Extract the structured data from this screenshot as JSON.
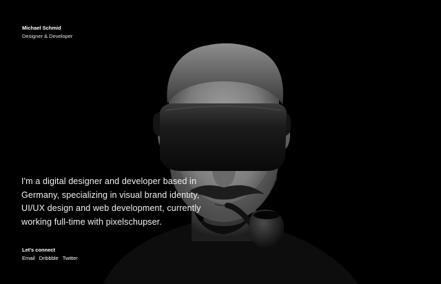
{
  "header": {
    "name": "Michael Schmid",
    "role": "Designer & Developer"
  },
  "intro": {
    "text": "I'm a digital designer and developer based in Germany, specializing in visual brand identity, UI/UX design and web development, currently working full-time with pixelschupser."
  },
  "connect": {
    "heading": "Let's connect",
    "links": [
      "Email",
      "Dribbble",
      "Twitter"
    ]
  },
  "colors": {
    "background": "#000000",
    "text": "#ffffff"
  }
}
